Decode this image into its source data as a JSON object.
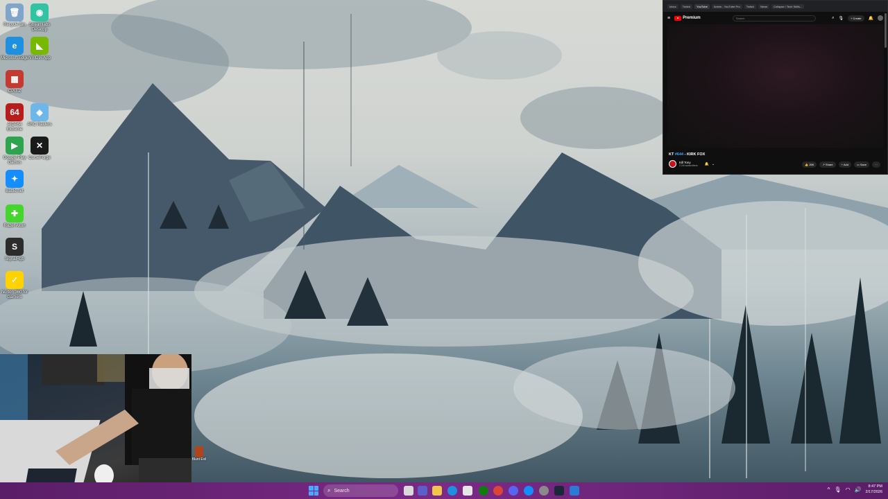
{
  "desktop": {
    "icons": [
      {
        "label": "Recycle Bin",
        "glyph": "🗑",
        "color": "#7fa6c9"
      },
      {
        "label": "Streamlabs Desktop",
        "glyph": "◉",
        "color": "#31c3a2"
      },
      {
        "label": "Microsoft Edge",
        "glyph": "e",
        "color": "#1f8fe0"
      },
      {
        "label": "NVIDIA App",
        "glyph": "◣",
        "color": "#76b900"
      },
      {
        "label": "CPU-Z",
        "glyph": "▦",
        "color": "#c43a31"
      },
      {
        "label": "AIDA64 Extreme",
        "glyph": "64",
        "color": "#b81d1d"
      },
      {
        "label": "ARC Raiders",
        "glyph": "◆",
        "color": "#6fb7e8"
      },
      {
        "label": "Google Play Games",
        "glyph": "▶",
        "color": "#2ea44f"
      },
      {
        "label": "CurseForge",
        "glyph": "✕",
        "color": "#1a1a1a"
      },
      {
        "label": "Battle.net",
        "glyph": "✦",
        "color": "#148eff"
      },
      {
        "label": "Razer Axon",
        "glyph": "✚",
        "color": "#44d62c"
      },
      {
        "label": "SignalRgb",
        "glyph": "S",
        "color": "#2c2c2c"
      },
      {
        "label": "Norton 360 for Gamers",
        "glyph": "✓",
        "color": "#ffd200"
      }
    ],
    "partial_icon_label": "Blunt Evil"
  },
  "youtube": {
    "tabs": [
      "Inbox",
      "Twitch",
      "YouTube",
      "Admin - YouTube Pro",
      "Twitch",
      "News",
      "Collapse / Tech Skills..."
    ],
    "logo_text": "Premium",
    "search_placeholder": "Search",
    "create_label": "+ Create",
    "video_title_prefix": "KT",
    "video_title_number": "#644",
    "video_title_rest": "- KIRK FOX",
    "channel_name": "Kill Tony",
    "channel_subs": "2.1M subscribers",
    "like_count": "26K",
    "share_label": "Share",
    "add_label": "Add",
    "save_label": "Save",
    "more_label": "···"
  },
  "taskbar": {
    "search_placeholder": "Search",
    "clock_time": "8:47 PM",
    "clock_date": "2/17/2026",
    "tray_overflow": "^",
    "accent": "#6f2479"
  }
}
